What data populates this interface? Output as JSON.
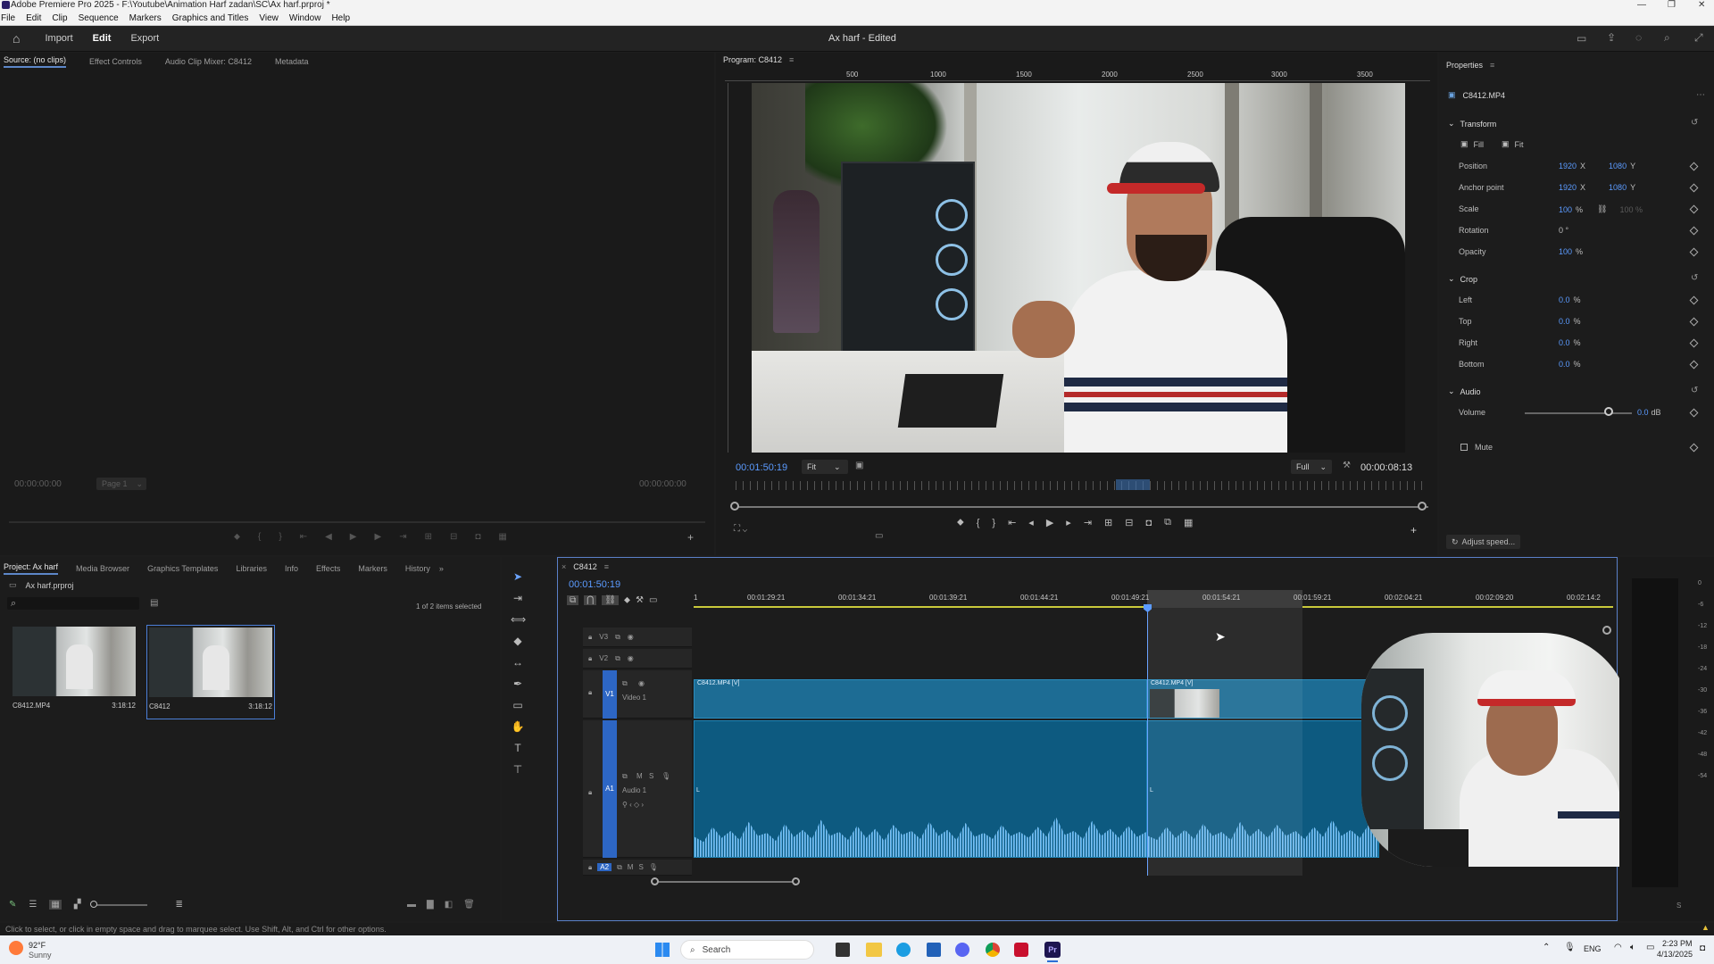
{
  "window": {
    "title": "Adobe Premiere Pro 2025 - F:\\Youtube\\Animation Harf zadan\\SC\\Ax harf.prproj *"
  },
  "menu": [
    "File",
    "Edit",
    "Clip",
    "Sequence",
    "Markers",
    "Graphics and Titles",
    "View",
    "Window",
    "Help"
  ],
  "header": {
    "workspaces": [
      "Import",
      "Edit",
      "Export"
    ],
    "active_workspace": "Edit",
    "project_title": "Ax harf - Edited"
  },
  "source_panel": {
    "tabs": [
      "Source: (no clips)",
      "Effect Controls",
      "Audio Clip Mixer: C8412",
      "Metadata"
    ],
    "timecode_left": "00:00:00:00",
    "page": "Page 1",
    "timecode_right": "00:00:00:00"
  },
  "program_panel": {
    "title": "Program: C8412",
    "ruler_labels": [
      "500",
      "1000",
      "1500",
      "2000",
      "2500",
      "3000",
      "3500"
    ],
    "timecode": "00:01:50:19",
    "fit": "Fit",
    "quality": "Full",
    "duration": "00:00:08:13",
    "scrub_position": 0.6
  },
  "properties": {
    "title": "Properties",
    "clip": "C8412.MP4",
    "transform_title": "Transform",
    "fill_label": "Fill",
    "fit_label": "Fit",
    "position": {
      "label": "Position",
      "x": "1920",
      "y": "1080",
      "xl": "X",
      "yl": "Y"
    },
    "anchor": {
      "label": "Anchor point",
      "x": "1920",
      "y": "1080",
      "xl": "X",
      "yl": "Y"
    },
    "scale": {
      "label": "Scale",
      "value": "100",
      "unit": "%",
      "linked": "100 %"
    },
    "rotation": {
      "label": "Rotation",
      "value": "0 °"
    },
    "opacity": {
      "label": "Opacity",
      "value": "100",
      "unit": "%"
    },
    "crop_title": "Crop",
    "crop": [
      {
        "label": "Left",
        "value": "0.0",
        "unit": "%"
      },
      {
        "label": "Top",
        "value": "0.0",
        "unit": "%"
      },
      {
        "label": "Right",
        "value": "0.0",
        "unit": "%"
      },
      {
        "label": "Bottom",
        "value": "0.0",
        "unit": "%"
      }
    ],
    "audio_title": "Audio",
    "volume": {
      "label": "Volume",
      "value": "0.0",
      "unit": "dB",
      "level": 0.78
    },
    "mute_label": "Mute",
    "adjust_speed": "Adjust speed..."
  },
  "project_panel": {
    "tabs": [
      "Project: Ax harf",
      "Media Browser",
      "Graphics Templates",
      "Libraries",
      "Info",
      "Effects",
      "Markers",
      "History"
    ],
    "file": "Ax harf.prproj",
    "selection": "1 of 2 items selected",
    "items": [
      {
        "name": "C8412.MP4",
        "duration": "3:18:12"
      },
      {
        "name": "C8412",
        "duration": "3:18:12"
      }
    ]
  },
  "timeline": {
    "sequence": "C8412",
    "timecode": "00:01:50:19",
    "ruler_start": "1",
    "ruler_labels": [
      "00:01:29:21",
      "00:01:34:21",
      "00:01:39:21",
      "00:01:44:21",
      "00:01:49:21",
      "00:01:54:21",
      "00:01:59:21",
      "00:02:04:21",
      "00:02:09:20",
      "00:02:14:2"
    ],
    "tracks": [
      {
        "id": "V3",
        "name": ""
      },
      {
        "id": "V2",
        "name": ""
      },
      {
        "id": "V1",
        "name": "Video 1"
      },
      {
        "id": "A1",
        "name": "Audio 1"
      },
      {
        "id": "A2",
        "name": ""
      }
    ],
    "clip1_label": "C8412.MP4 [V]",
    "clip2_label": "C8412.MP4 [V]",
    "audio_marker": "L",
    "meter_ticks": [
      "0",
      "-6",
      "-12",
      "-18",
      "-24",
      "-30",
      "-36",
      "-42",
      "-48",
      "-54"
    ],
    "meter_bottom": "S"
  },
  "statusbar": {
    "text": "Click to select, or click in empty space and drag to marquee select. Use Shift, Alt, and Ctrl for other options."
  },
  "taskbar": {
    "weather_temp": "92°F",
    "weather_desc": "Sunny",
    "search": "Search",
    "lang": "ENG",
    "time": "2:23 PM",
    "date": "4/13/2025"
  }
}
